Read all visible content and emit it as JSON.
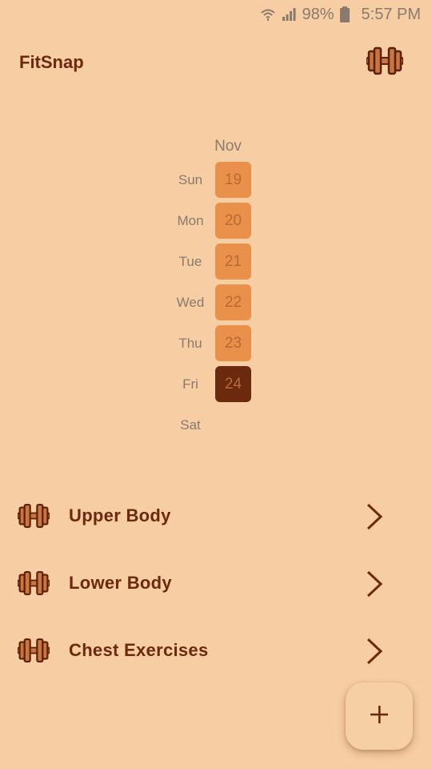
{
  "status_bar": {
    "battery": "98%",
    "time": "5:57 PM",
    "icons": [
      "wifi-icon",
      "signal-icon",
      "battery-icon"
    ]
  },
  "app_bar": {
    "title": "FitSnap",
    "action_icon": "dumbbell-icon"
  },
  "calendar": {
    "month": "Nov",
    "days": [
      {
        "name": "Sun",
        "date": "19",
        "state": "active"
      },
      {
        "name": "Mon",
        "date": "20",
        "state": "active"
      },
      {
        "name": "Tue",
        "date": "21",
        "state": "active"
      },
      {
        "name": "Wed",
        "date": "22",
        "state": "active"
      },
      {
        "name": "Thu",
        "date": "23",
        "state": "active"
      },
      {
        "name": "Fri",
        "date": "24",
        "state": "selected"
      },
      {
        "name": "Sat",
        "date": "",
        "state": "empty"
      }
    ]
  },
  "workouts": [
    {
      "label": "Upper Body",
      "icon": "dumbbell-icon"
    },
    {
      "label": "Lower Body",
      "icon": "dumbbell-icon"
    },
    {
      "label": "Chest Exercises",
      "icon": "dumbbell-icon"
    }
  ],
  "fab": {
    "icon": "plus-icon"
  },
  "colors": {
    "background": "#f7cda3",
    "primary_text": "#6b2a0e",
    "day_active": "#e9914a",
    "day_selected": "#6b2a0e",
    "muted_text": "#8a7a6e"
  }
}
